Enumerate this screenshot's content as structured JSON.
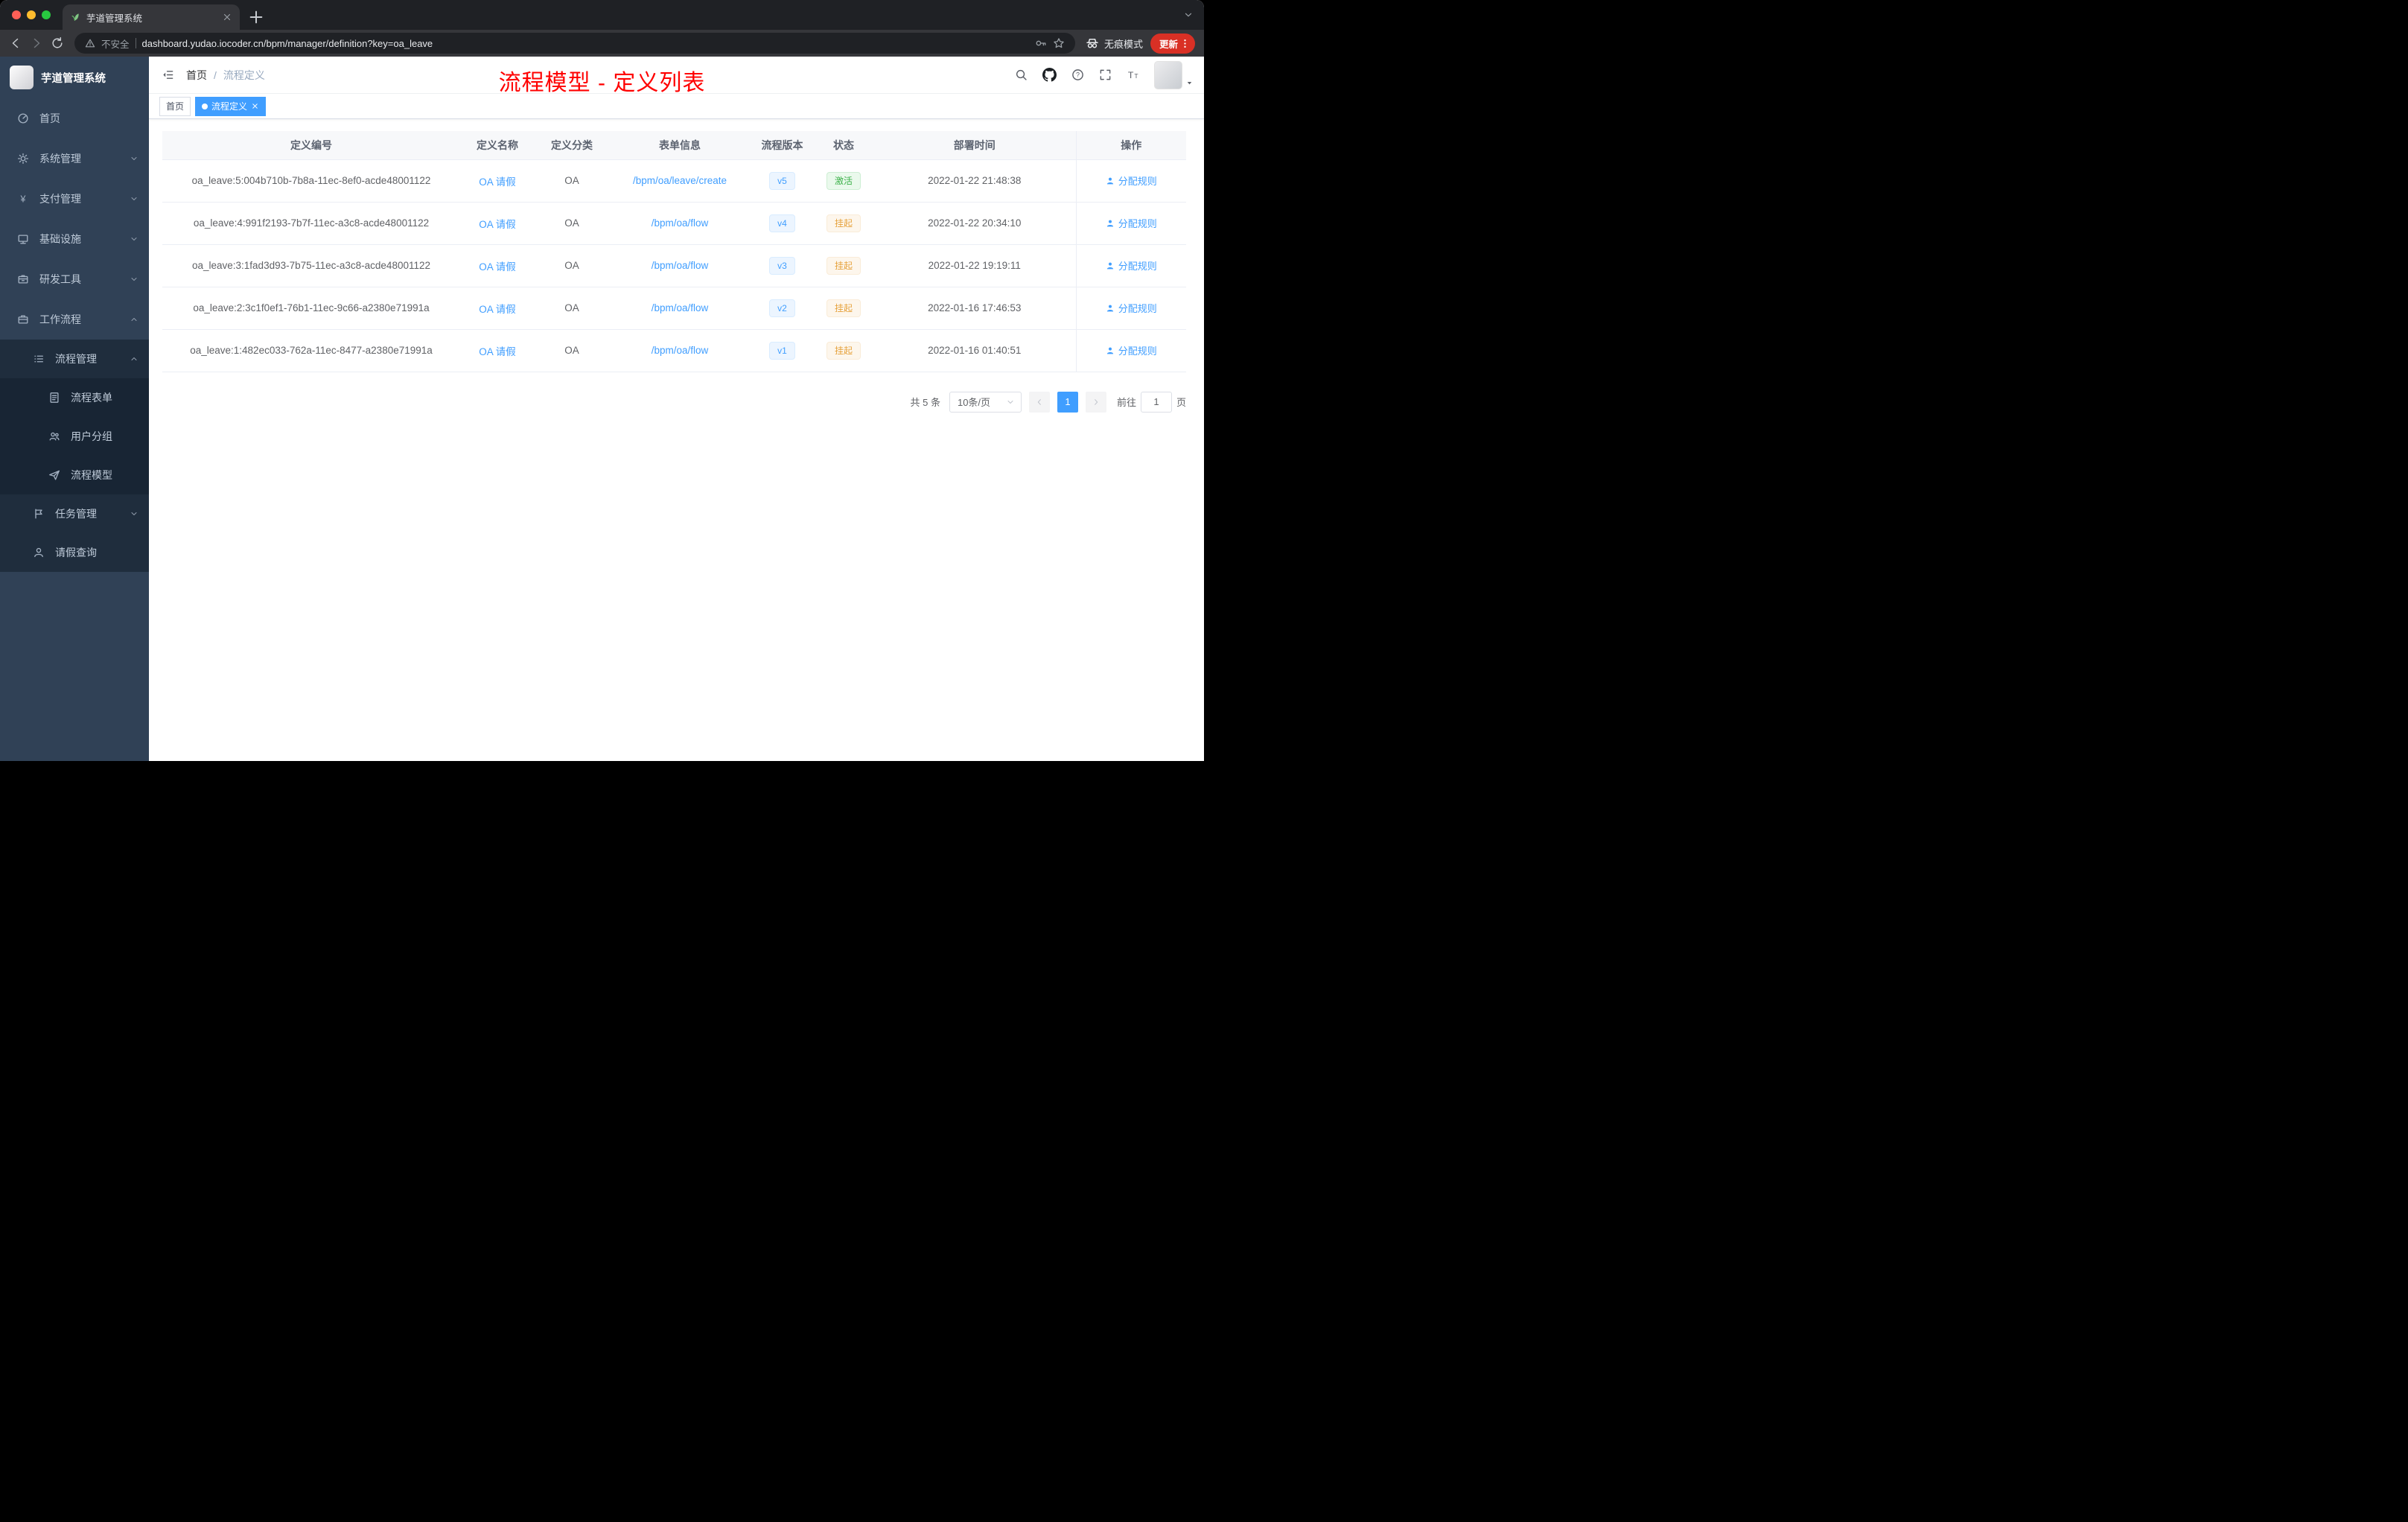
{
  "browser": {
    "tab_title": "芋道管理系统",
    "not_secure_label": "不安全",
    "url": "dashboard.yudao.iocoder.cn/bpm/manager/definition?key=oa_leave",
    "incognito_label": "无痕模式",
    "update_label": "更新"
  },
  "sidebar": {
    "logo_title": "芋道管理系统",
    "items": [
      {
        "key": "home",
        "label": "首页",
        "icon": "dashboard-icon",
        "level": 1,
        "chevron": null,
        "dark": false
      },
      {
        "key": "system",
        "label": "系统管理",
        "icon": "gear-icon",
        "level": 1,
        "chevron": "down",
        "dark": false
      },
      {
        "key": "payment",
        "label": "支付管理",
        "icon": "yen-icon",
        "level": 1,
        "chevron": "down",
        "dark": false
      },
      {
        "key": "infrastructure",
        "label": "基础设施",
        "icon": "monitor-icon",
        "level": 1,
        "chevron": "down",
        "dark": false
      },
      {
        "key": "dev-tools",
        "label": "研发工具",
        "icon": "toolbox-icon",
        "level": 1,
        "chevron": "down",
        "dark": false
      },
      {
        "key": "workflow",
        "label": "工作流程",
        "icon": "briefcase-icon",
        "level": 1,
        "chevron": "up",
        "dark": false
      },
      {
        "key": "process-mgmt",
        "label": "流程管理",
        "icon": "list-icon",
        "level": 2,
        "chevron": "up",
        "dark": true
      },
      {
        "key": "process-form",
        "label": "流程表单",
        "icon": "form-icon",
        "level": 3,
        "chevron": null,
        "dark": true
      },
      {
        "key": "user-group",
        "label": "用户分组",
        "icon": "users-icon",
        "level": 3,
        "chevron": null,
        "dark": true
      },
      {
        "key": "process-model",
        "label": "流程模型",
        "icon": "send-icon",
        "level": 3,
        "chevron": null,
        "dark": true
      },
      {
        "key": "task-mgmt",
        "label": "任务管理",
        "icon": "task-icon",
        "level": 2,
        "chevron": "down",
        "dark": true
      },
      {
        "key": "leave-query",
        "label": "请假查询",
        "icon": "user-icon",
        "level": 2,
        "chevron": null,
        "dark": true
      }
    ]
  },
  "header": {
    "breadcrumb": {
      "home": "首页",
      "separator": "/",
      "current": "流程定义"
    },
    "overlay_title": "流程模型 - 定义列表",
    "icons": [
      "search-icon",
      "github-icon",
      "question-icon",
      "fullscreen-icon",
      "font-size-icon"
    ]
  },
  "tags": [
    {
      "label": "首页",
      "active": false,
      "closable": false
    },
    {
      "label": "流程定义",
      "active": true,
      "closable": true
    }
  ],
  "table": {
    "columns": [
      "定义编号",
      "定义名称",
      "定义分类",
      "表单信息",
      "流程版本",
      "状态",
      "部署时间",
      "操作"
    ],
    "rows": [
      {
        "id": "oa_leave:5:004b710b-7b8a-11ec-8ef0-acde48001122",
        "name": "OA 请假",
        "category": "OA",
        "form": "/bpm/oa/leave/create",
        "version": "v5",
        "status": "激活",
        "status_type": "success",
        "time": "2022-01-22 21:48:38",
        "action": "分配规则"
      },
      {
        "id": "oa_leave:4:991f2193-7b7f-11ec-a3c8-acde48001122",
        "name": "OA 请假",
        "category": "OA",
        "form": "/bpm/oa/flow",
        "version": "v4",
        "status": "挂起",
        "status_type": "warning",
        "time": "2022-01-22 20:34:10",
        "action": "分配规则"
      },
      {
        "id": "oa_leave:3:1fad3d93-7b75-11ec-a3c8-acde48001122",
        "name": "OA 请假",
        "category": "OA",
        "form": "/bpm/oa/flow",
        "version": "v3",
        "status": "挂起",
        "status_type": "warning",
        "time": "2022-01-22 19:19:11",
        "action": "分配规则"
      },
      {
        "id": "oa_leave:2:3c1f0ef1-76b1-11ec-9c66-a2380e71991a",
        "name": "OA 请假",
        "category": "OA",
        "form": "/bpm/oa/flow",
        "version": "v2",
        "status": "挂起",
        "status_type": "warning",
        "time": "2022-01-16 17:46:53",
        "action": "分配规则"
      },
      {
        "id": "oa_leave:1:482ec033-762a-11ec-8477-a2380e71991a",
        "name": "OA 请假",
        "category": "OA",
        "form": "/bpm/oa/flow",
        "version": "v1",
        "status": "挂起",
        "status_type": "warning",
        "time": "2022-01-16 01:40:51",
        "action": "分配规则"
      }
    ]
  },
  "pagination": {
    "total": "共 5 条",
    "page_size": "10条/页",
    "current_page": "1",
    "goto_label": "前往",
    "goto_value": "1",
    "page_unit": "页"
  },
  "colors": {
    "accent": "#409eff",
    "success": "#3cb14a",
    "warning": "#e6a23c",
    "overlay_title_red": "#ff0000",
    "sidebar_bg": "#304156",
    "submenu_bg": "#1f2d3d"
  }
}
